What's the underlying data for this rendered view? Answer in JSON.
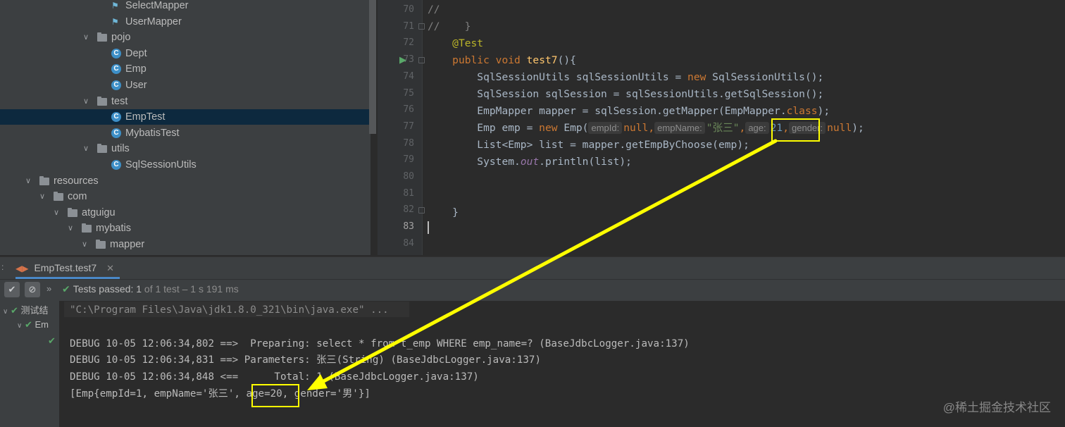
{
  "project_tree": {
    "items": [
      {
        "label": "SelectMapper",
        "type": "mapper"
      },
      {
        "label": "UserMapper",
        "type": "mapper"
      },
      {
        "label": "pojo",
        "type": "folder"
      },
      {
        "label": "Dept",
        "type": "class"
      },
      {
        "label": "Emp",
        "type": "class"
      },
      {
        "label": "User",
        "type": "class"
      },
      {
        "label": "test",
        "type": "folder"
      },
      {
        "label": "EmpTest",
        "type": "test-class",
        "selected": true
      },
      {
        "label": "MybatisTest",
        "type": "test-class"
      },
      {
        "label": "utils",
        "type": "folder"
      },
      {
        "label": "SqlSessionUtils",
        "type": "class"
      },
      {
        "label": "resources",
        "type": "resource-folder"
      },
      {
        "label": "com",
        "type": "folder"
      },
      {
        "label": "atguigu",
        "type": "folder"
      },
      {
        "label": "mybatis",
        "type": "folder"
      },
      {
        "label": "mapper",
        "type": "folder"
      }
    ]
  },
  "editor": {
    "line_numbers": [
      "70",
      "71",
      "72",
      "73",
      "74",
      "75",
      "76",
      "77",
      "78",
      "79",
      "80",
      "81",
      "82",
      "83",
      "84"
    ],
    "current_line": "83",
    "code": {
      "l70": "//",
      "l71a": "//",
      "l71b": "}",
      "l72": "@Test",
      "l73_kw1": "public",
      "l73_kw2": "void",
      "l73_fn": "test7",
      "l73_rest": "(){",
      "l74a": "SqlSessionUtils sqlSessionUtils = ",
      "l74_kw": "new",
      "l74b": " SqlSessionUtils();",
      "l75": "SqlSession sqlSession = sqlSessionUtils.getSqlSession();",
      "l76a": "EmpMapper mapper = sqlSession.getMapper(EmpMapper.",
      "l76_kw": "class",
      "l76b": ");",
      "l77a": "Emp emp = ",
      "l77_kw": "new",
      "l77b": " Emp(",
      "hint_empId": "empId:",
      "l77_null1": "null",
      "comma": ",",
      "hint_empName": "empName:",
      "l77_str": "\"张三\"",
      "hint_age": "age:",
      "l77_age": "21",
      "hint_gender": "gender:",
      "l77_null2": "null",
      "l77_end": ");",
      "l78": "List<Emp> list = mapper.getEmpByChoose(emp);",
      "l79a": "System.",
      "l79_out": "out",
      "l79b": ".println(list);",
      "l82": "}"
    }
  },
  "run_panel": {
    "tab_label": "EmpTest.test7",
    "status_label": "Tests passed:",
    "status_count": "1",
    "status_rest": "of 1 test – 1 s 191 ms",
    "tree_root": "测试结",
    "tree_child": "Em",
    "console": {
      "cmd": "\"C:\\Program Files\\Java\\jdk1.8.0_321\\bin\\java.exe\" ...",
      "line1": "DEBUG 10-05 12:06:34,802 ==>  Preparing: select * from t_emp WHERE emp_name=? (BaseJdbcLogger.java:137)",
      "line2": "DEBUG 10-05 12:06:34,831 ==> Parameters: 张三(String) (BaseJdbcLogger.java:137)",
      "line3": "DEBUG 10-05 12:06:34,848 <==      Total: 1 (BaseJdbcLogger.java:137)",
      "line4": "[Emp{empId=1, empName='张三', age=20, gender='男'}]"
    }
  },
  "watermark": "@稀土掘金技术社区",
  "colors": {
    "annotation": "#ffff00",
    "accent_pass": "#59a869"
  }
}
